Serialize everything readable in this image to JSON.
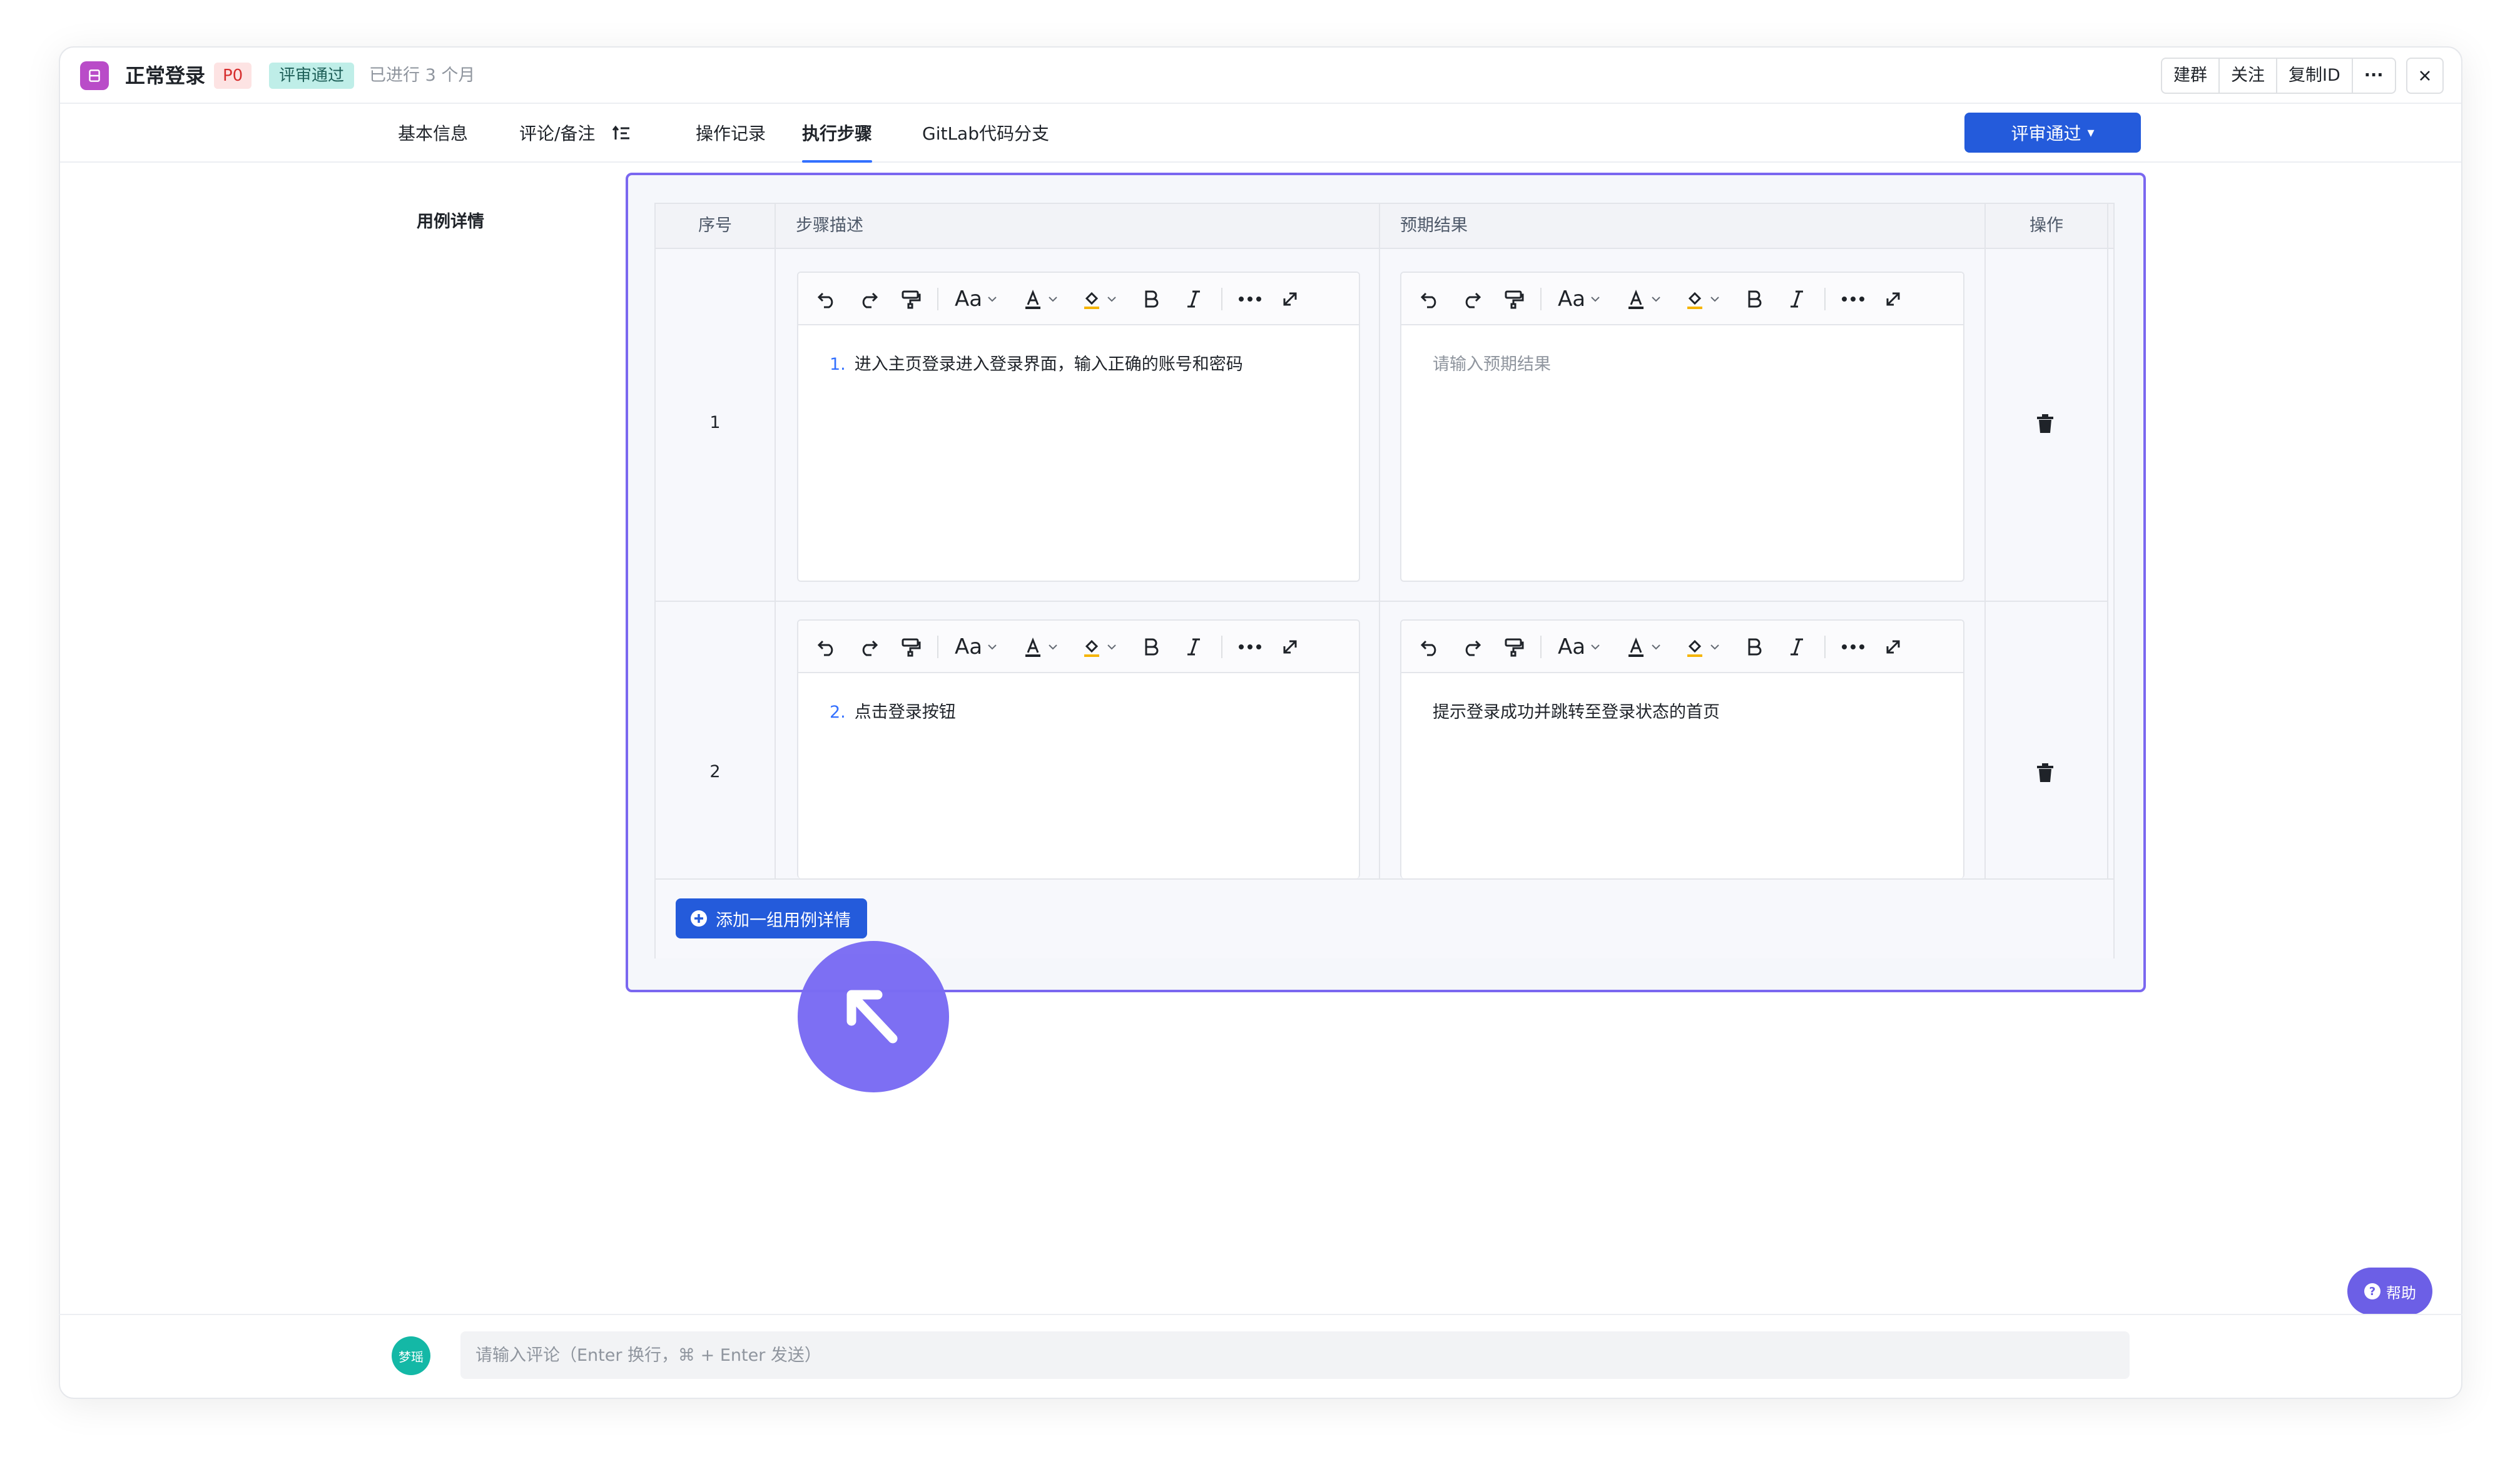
{
  "header": {
    "title": "正常登录",
    "priority": "P0",
    "status": "评审通过",
    "time": "已进行 3 个月",
    "actions": [
      "建群",
      "关注",
      "复制ID",
      "···"
    ]
  },
  "tabs": [
    {
      "label": "基本信息"
    },
    {
      "label": "评论/备注"
    },
    {
      "label": "操作记录"
    },
    {
      "label": "执行步骤"
    },
    {
      "label": "GitLab代码分支"
    }
  ],
  "active_tab": "执行步骤",
  "review_button": {
    "label": "评审通过",
    "caret": "▾"
  },
  "section_label": "用例详情",
  "table": {
    "columns": [
      "序号",
      "步骤描述",
      "预期结果",
      "操作"
    ],
    "rows": [
      {
        "index": "1",
        "step_number": "1.",
        "step": "进入主页登录进入登录界面，输入正确的账号和密码",
        "expected": "",
        "expected_placeholder": "请输入预期结果"
      },
      {
        "index": "2",
        "step_number": "2.",
        "step": "点击登录按钮",
        "expected": "提示登录成功并跳转至登录状态的首页",
        "expected_placeholder": ""
      }
    ],
    "toolbar": {
      "font_size": "Aa"
    }
  },
  "add_button": {
    "label": "添加一组用例详情"
  },
  "help": {
    "label": "帮助"
  },
  "comment": {
    "avatar_text": "梦瑶",
    "placeholder": "请输入评论（Enter 换行，⌘ + Enter 发送）"
  },
  "colors": {
    "primary": "#245bdb",
    "focus_border": "#7a67f0",
    "p0_bg": "#fde3e3",
    "status_bg": "#bfeee8",
    "avatar": "#14b8a6"
  }
}
